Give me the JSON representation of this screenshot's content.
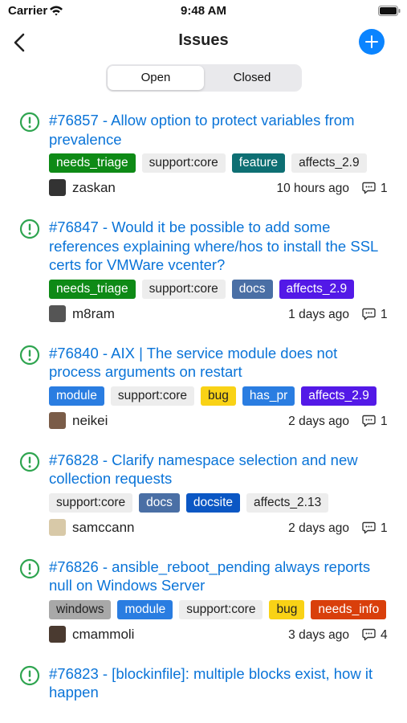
{
  "status": {
    "carrier": "Carrier",
    "time": "9:48 AM"
  },
  "nav": {
    "title": "Issues"
  },
  "tabs": [
    {
      "label": "Open",
      "active": true
    },
    {
      "label": "Closed",
      "active": false
    }
  ],
  "colors": {
    "accent": "#0a84ff",
    "link": "#0a74d8",
    "open_icon": "#2ea44f"
  },
  "issues": [
    {
      "title": "#76857 - Allow option to protect variables from prevalence",
      "labels": [
        {
          "text": "needs_triage",
          "bg": "#0e8a16",
          "fg": "#ffffff"
        },
        {
          "text": "support:core",
          "bg": "#ededed",
          "fg": "#222222"
        },
        {
          "text": "feature",
          "bg": "#0e6f73",
          "fg": "#ffffff"
        },
        {
          "text": "affects_2.9",
          "bg": "#ededed",
          "fg": "#222222"
        }
      ],
      "author": "zaskan",
      "time": "10 hours ago",
      "comments": "1"
    },
    {
      "title": "#76847 - Would it be possible to add some references explaining where/hos to install the SSL certs for VMWare vcenter?",
      "labels": [
        {
          "text": "needs_triage",
          "bg": "#0e8a16",
          "fg": "#ffffff"
        },
        {
          "text": "support:core",
          "bg": "#ededed",
          "fg": "#222222"
        },
        {
          "text": "docs",
          "bg": "#4a6fa5",
          "fg": "#ffffff"
        },
        {
          "text": "affects_2.9",
          "bg": "#5319e7",
          "fg": "#ffffff"
        }
      ],
      "author": "m8ram",
      "time": "1 days ago",
      "comments": "1"
    },
    {
      "title": "#76840 - AIX | The service module does not process arguments on restart",
      "labels": [
        {
          "text": "module",
          "bg": "#2a7de1",
          "fg": "#ffffff"
        },
        {
          "text": "support:core",
          "bg": "#ededed",
          "fg": "#222222"
        },
        {
          "text": "bug",
          "bg": "#f9d216",
          "fg": "#222222"
        },
        {
          "text": "has_pr",
          "bg": "#2a7de1",
          "fg": "#ffffff"
        },
        {
          "text": "affects_2.9",
          "bg": "#5319e7",
          "fg": "#ffffff"
        }
      ],
      "author": "neikei",
      "time": "2 days ago",
      "comments": "1"
    },
    {
      "title": "#76828 - Clarify namespace selection and new collection requests",
      "labels": [
        {
          "text": "support:core",
          "bg": "#ededed",
          "fg": "#222222"
        },
        {
          "text": "docs",
          "bg": "#4a6fa5",
          "fg": "#ffffff"
        },
        {
          "text": "docsite",
          "bg": "#0b57c4",
          "fg": "#ffffff"
        },
        {
          "text": "affects_2.13",
          "bg": "#ededed",
          "fg": "#222222"
        }
      ],
      "author": "samccann",
      "time": "2 days ago",
      "comments": "1"
    },
    {
      "title": "#76826 - ansible_reboot_pending always reports null on Windows Server",
      "labels": [
        {
          "text": "windows",
          "bg": "#a8a8a8",
          "fg": "#222222"
        },
        {
          "text": "module",
          "bg": "#2a7de1",
          "fg": "#ffffff"
        },
        {
          "text": "support:core",
          "bg": "#ededed",
          "fg": "#222222"
        },
        {
          "text": "bug",
          "bg": "#f9d216",
          "fg": "#222222"
        },
        {
          "text": "needs_info",
          "bg": "#d93f0b",
          "fg": "#ffffff"
        }
      ],
      "author": "cmammoli",
      "time": "3 days ago",
      "comments": "4"
    },
    {
      "title": "#76823 - [blockinfile]: multiple blocks exist, how it happen",
      "labels": [],
      "author": "",
      "time": "",
      "comments": ""
    }
  ]
}
